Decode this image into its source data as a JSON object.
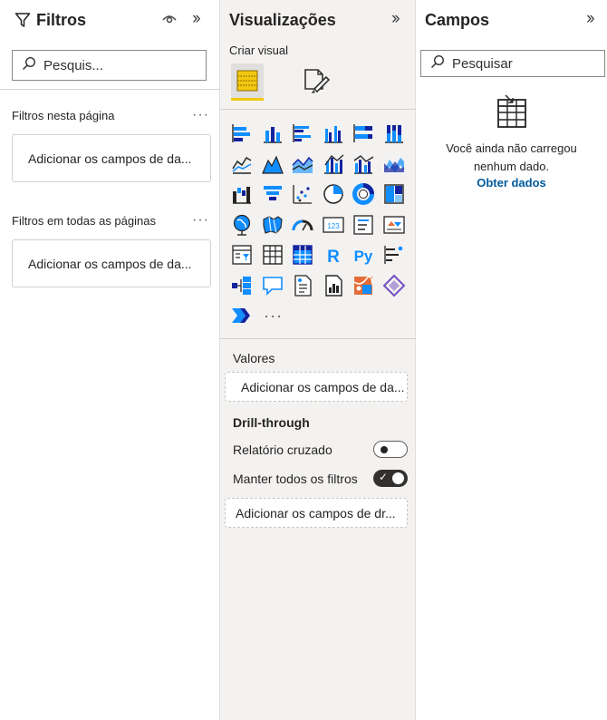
{
  "filters": {
    "title": "Filtros",
    "search_placeholder": "Pesquis...",
    "page_filters_label": "Filtros nesta página",
    "page_filters_well": "Adicionar os campos de da...",
    "all_pages_label": "Filtros em todas as páginas",
    "all_pages_well": "Adicionar os campos de da..."
  },
  "visualizations": {
    "title": "Visualizações",
    "create_visual_label": "Criar visual",
    "more_label": "···",
    "values_label": "Valores",
    "values_well": "Adicionar os campos de da...",
    "drillthrough_label": "Drill-through",
    "cross_report_label": "Relatório cruzado",
    "cross_report_on": false,
    "keep_filters_label": "Manter todos os filtros",
    "keep_filters_on": true,
    "drillthrough_well": "Adicionar os campos de dr...",
    "accent_color": "#f2c811",
    "icon_color": "#118dff",
    "visual_icons": [
      "stacked-bar-chart-icon",
      "stacked-column-chart-icon",
      "clustered-bar-chart-icon",
      "clustered-column-chart-icon",
      "100-stacked-bar-chart-icon",
      "100-stacked-column-chart-icon",
      "line-chart-icon",
      "area-chart-icon",
      "stacked-area-chart-icon",
      "line-and-stacked-column-icon",
      "line-and-clustered-column-icon",
      "ribbon-chart-icon",
      "waterfall-chart-icon",
      "funnel-chart-icon",
      "scatter-chart-icon",
      "pie-chart-icon",
      "donut-chart-icon",
      "treemap-icon",
      "map-icon",
      "filled-map-icon",
      "gauge-icon",
      "card-icon",
      "multi-row-card-icon",
      "kpi-icon",
      "slicer-icon",
      "table-icon",
      "matrix-icon",
      "r-visual-icon",
      "python-visual-icon",
      "key-influencers-icon",
      "decomposition-tree-icon",
      "qa-icon",
      "smart-narrative-icon",
      "paginated-report-icon",
      "arcgis-map-icon",
      "power-apps-icon",
      "power-automate-icon"
    ]
  },
  "fields": {
    "title": "Campos",
    "search_placeholder": "Pesquisar",
    "empty_line1": "Você ainda não carregou",
    "empty_line2": "nenhum dado.",
    "get_data_link": "Obter dados",
    "link_color": "#005a9e"
  }
}
